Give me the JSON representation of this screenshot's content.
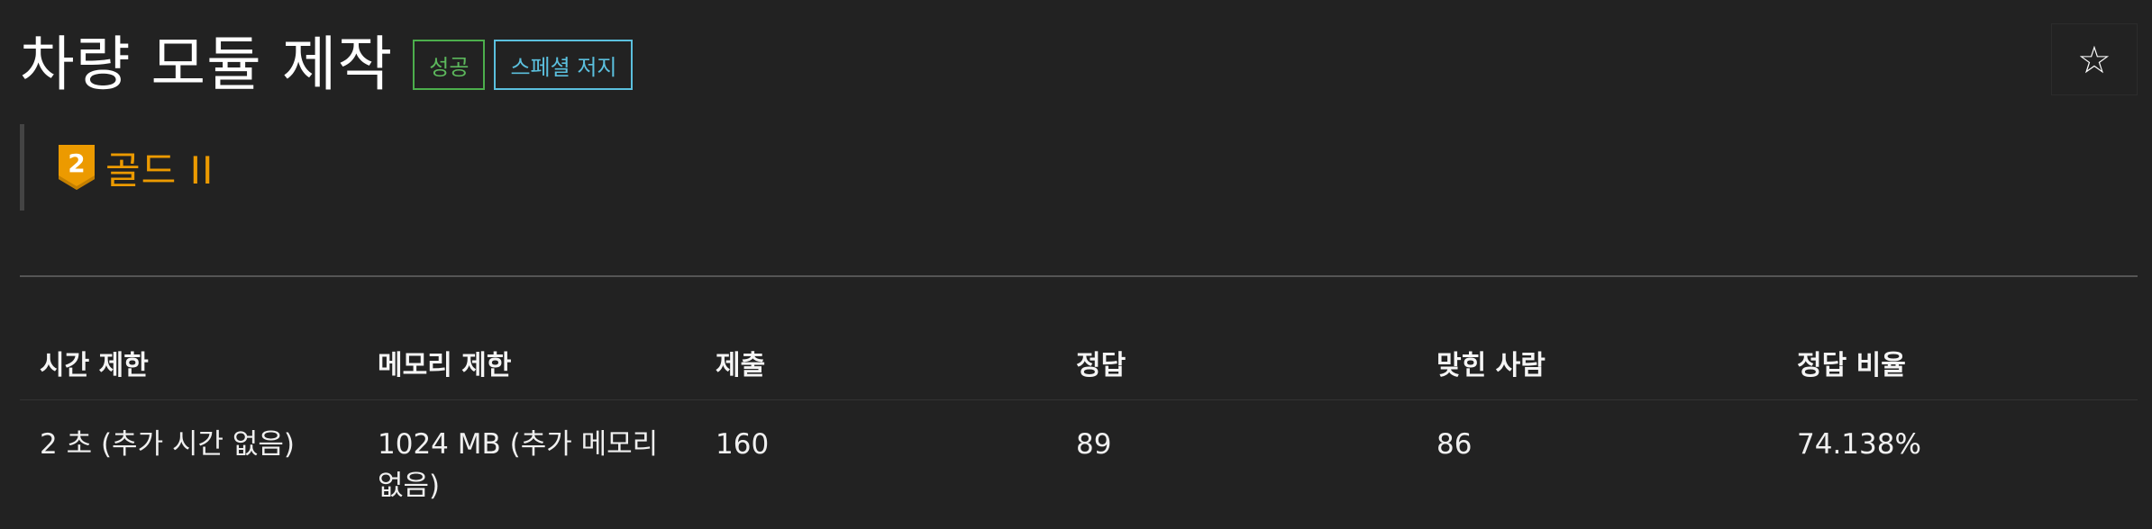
{
  "problem": {
    "title": "차량 모듈 제작",
    "badges": {
      "success": "성공",
      "special_judge": "스페셜 저지"
    },
    "star_icon": "☆",
    "tier": {
      "icon_number": "2",
      "label": "골드 II",
      "color": "#ec9a00"
    }
  },
  "colors": {
    "background": "#222222",
    "success": "#5cb85c",
    "special": "#5bc0de",
    "tier_gold": "#ec9a00"
  },
  "info_table": {
    "headers": {
      "time_limit": "시간 제한",
      "memory_limit": "메모리 제한",
      "submissions": "제출",
      "accepted": "정답",
      "solvers": "맞힌 사람",
      "ratio": "정답 비율"
    },
    "values": {
      "time_limit": "2 초 (추가 시간 없음)",
      "memory_limit": "1024 MB (추가 메모리 없음)",
      "submissions": "160",
      "accepted": "89",
      "solvers": "86",
      "ratio": "74.138%"
    }
  }
}
